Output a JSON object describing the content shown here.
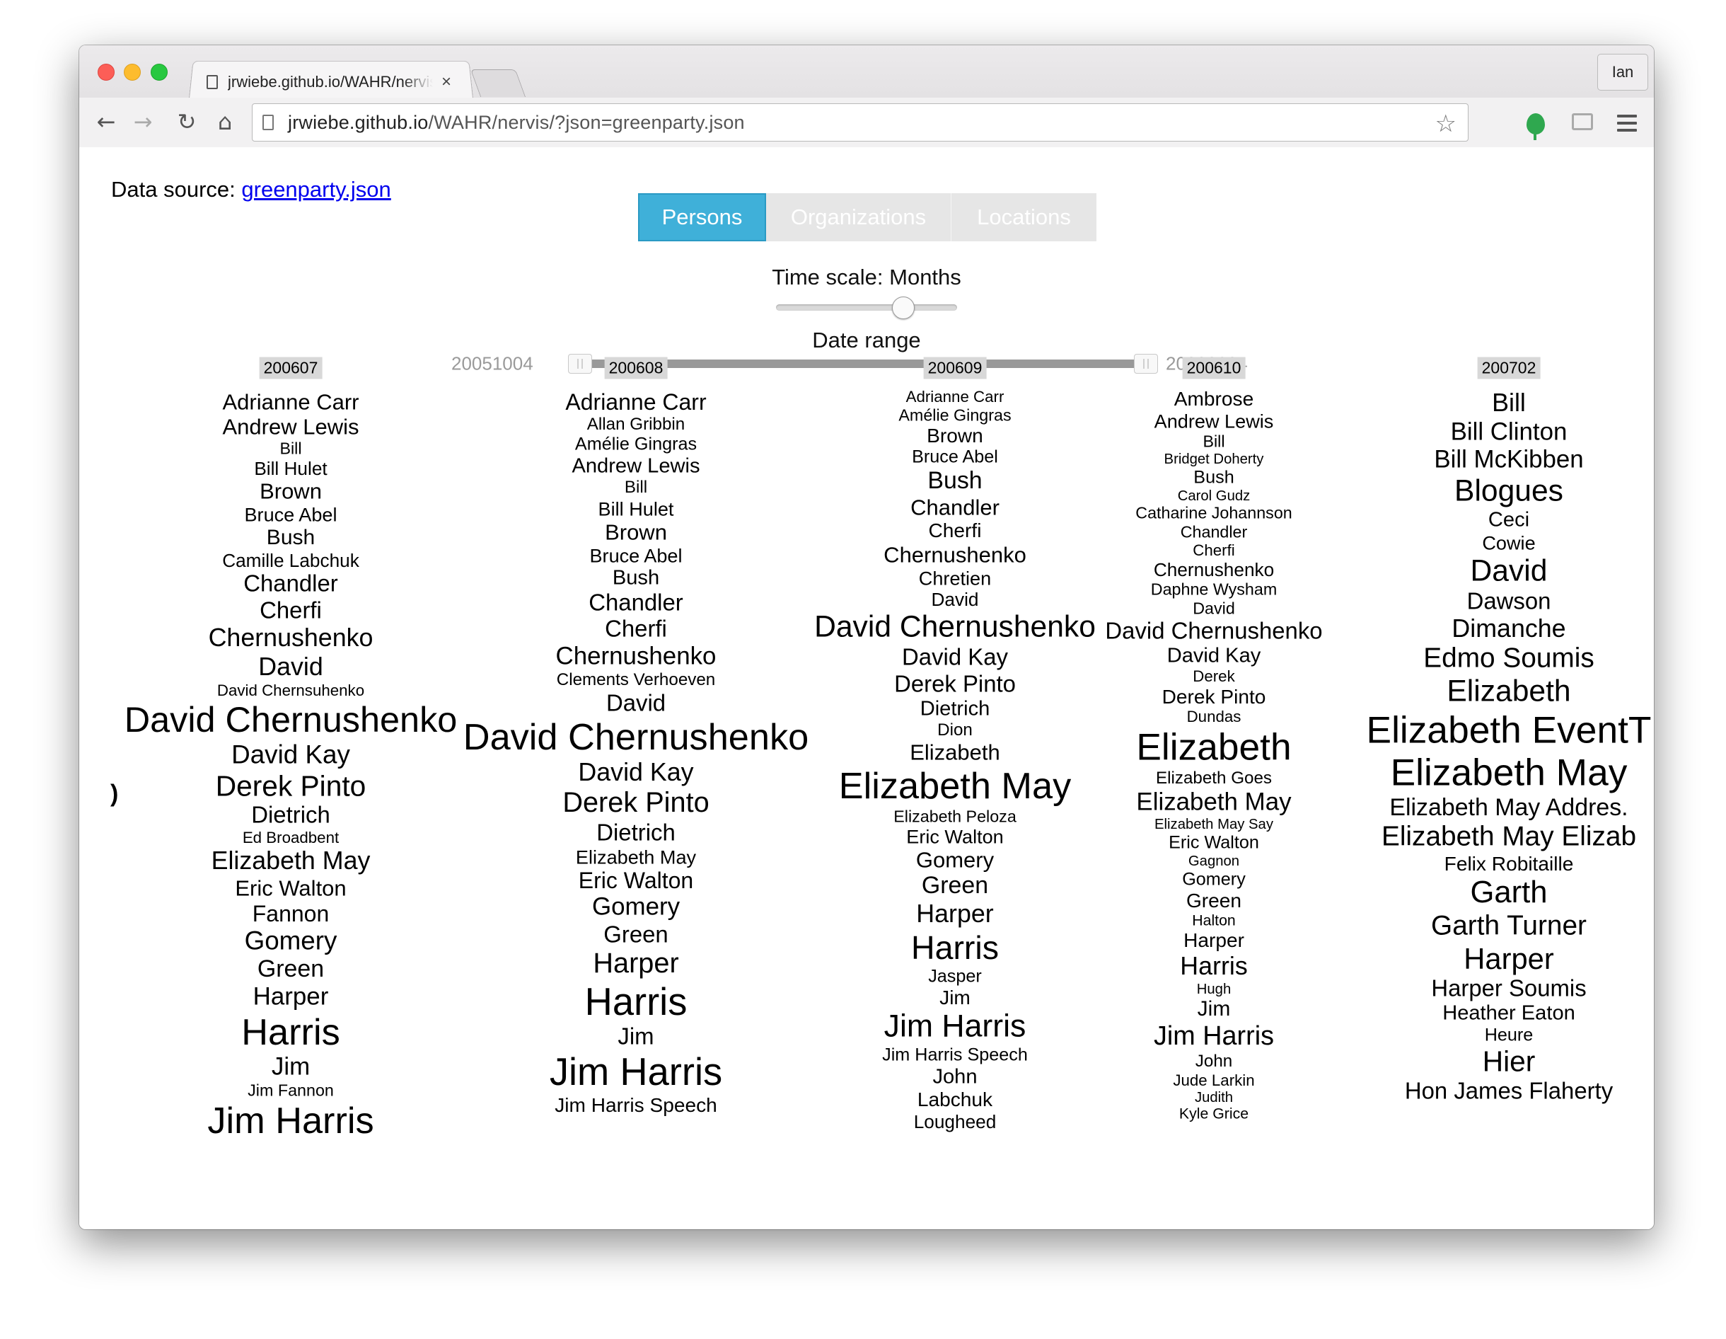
{
  "browser": {
    "tab_title": "jrwiebe.github.io/WAHR/nervis/?json=greenparty.json",
    "tab_close_glyph": "×",
    "profile_label": "Ian",
    "url_host": "jrwiebe.github.io",
    "url_path": "/WAHR/nervis/?json=greenparty.json",
    "icons": {
      "back": "back-arrow-icon",
      "forward": "forward-arrow-icon",
      "reload": "reload-icon",
      "home": "home-icon",
      "star": "star-icon",
      "extension": "evernote-extension-icon",
      "cast": "cast-icon",
      "menu": "hamburger-menu-icon"
    }
  },
  "page": {
    "data_source_label": "Data source:",
    "data_source_link": "greenparty.json",
    "tabs": [
      {
        "label": "Persons",
        "active": true
      },
      {
        "label": "Organizations",
        "active": false
      },
      {
        "label": "Locations",
        "active": false
      }
    ],
    "accent_color": "#3fb0d9",
    "time_scale_label": "Time scale: Months",
    "time_scale_value": "Months",
    "date_range_label": "Date range",
    "date_range_min": "20051004",
    "date_range_max": "20090204",
    "edge_glyph": ")"
  },
  "columns": [
    {
      "header": "200607",
      "words": [
        {
          "text": "Adrianne Carr",
          "size": 32
        },
        {
          "text": "Andrew Lewis",
          "size": 32
        },
        {
          "text": "Bill",
          "size": 24
        },
        {
          "text": "Bill Hulet",
          "size": 27
        },
        {
          "text": "Brown",
          "size": 32
        },
        {
          "text": "Bruce Abel",
          "size": 28
        },
        {
          "text": "Bush",
          "size": 31
        },
        {
          "text": "Camille Labchuk",
          "size": 27
        },
        {
          "text": "Chandler",
          "size": 34
        },
        {
          "text": "Cherfi",
          "size": 34
        },
        {
          "text": "Chernushenko",
          "size": 37
        },
        {
          "text": "David",
          "size": 37
        },
        {
          "text": "David Chernsuhenko",
          "size": 23
        },
        {
          "text": "David Chernushenko",
          "size": 52
        },
        {
          "text": "David Kay",
          "size": 38
        },
        {
          "text": "Derek Pinto",
          "size": 42
        },
        {
          "text": "Dietrich",
          "size": 34
        },
        {
          "text": "Ed Broadbent",
          "size": 23
        },
        {
          "text": "Elizabeth May",
          "size": 37
        },
        {
          "text": "Eric Walton",
          "size": 32
        },
        {
          "text": "Fannon",
          "size": 33
        },
        {
          "text": "Gomery",
          "size": 38
        },
        {
          "text": "Green",
          "size": 35
        },
        {
          "text": "Harper",
          "size": 36
        },
        {
          "text": "Harris",
          "size": 54
        },
        {
          "text": "Jim",
          "size": 36
        },
        {
          "text": "Jim Fannon",
          "size": 24
        },
        {
          "text": "Jim Harris",
          "size": 54
        }
      ]
    },
    {
      "header": "200608",
      "words": [
        {
          "text": "Adrianne Carr",
          "size": 33
        },
        {
          "text": "Allan Gribbin",
          "size": 25
        },
        {
          "text": "Amélie Gingras",
          "size": 26
        },
        {
          "text": "Andrew Lewis",
          "size": 30
        },
        {
          "text": "Bill",
          "size": 25
        },
        {
          "text": "Bill Hulet",
          "size": 28
        },
        {
          "text": "Brown",
          "size": 32
        },
        {
          "text": "Bruce Abel",
          "size": 28
        },
        {
          "text": "Bush",
          "size": 30
        },
        {
          "text": "Chandler",
          "size": 34
        },
        {
          "text": "Cherfi",
          "size": 34
        },
        {
          "text": "Chernushenko",
          "size": 36
        },
        {
          "text": "Clements Verhoeven",
          "size": 25
        },
        {
          "text": "David",
          "size": 34
        },
        {
          "text": "David Chernushenko",
          "size": 54
        },
        {
          "text": "David Kay",
          "size": 37
        },
        {
          "text": "Derek Pinto",
          "size": 41
        },
        {
          "text": "Dietrich",
          "size": 34
        },
        {
          "text": "Elizabeth May",
          "size": 28
        },
        {
          "text": "Eric Walton",
          "size": 33
        },
        {
          "text": "Gomery",
          "size": 36
        },
        {
          "text": "Green",
          "size": 34
        },
        {
          "text": "Harper",
          "size": 41
        },
        {
          "text": "Harris",
          "size": 56
        },
        {
          "text": "Jim",
          "size": 34
        },
        {
          "text": "Jim Harris",
          "size": 56
        },
        {
          "text": "Jim Harris Speech",
          "size": 29
        }
      ]
    },
    {
      "header": "200609",
      "words": [
        {
          "text": "Adrianne Carr",
          "size": 23
        },
        {
          "text": "Amélie Gingras",
          "size": 24
        },
        {
          "text": "Brown",
          "size": 29
        },
        {
          "text": "Bruce Abel",
          "size": 26
        },
        {
          "text": "Bush",
          "size": 35
        },
        {
          "text": "Chandler",
          "size": 32
        },
        {
          "text": "Cherfi",
          "size": 29
        },
        {
          "text": "Chernushenko",
          "size": 32
        },
        {
          "text": "Chretien",
          "size": 28
        },
        {
          "text": "David",
          "size": 27
        },
        {
          "text": "David Chernushenko",
          "size": 44
        },
        {
          "text": "David Kay",
          "size": 34
        },
        {
          "text": "Derek Pinto",
          "size": 34
        },
        {
          "text": "Dietrich",
          "size": 30
        },
        {
          "text": "Dion",
          "size": 25
        },
        {
          "text": "Elizabeth",
          "size": 32
        },
        {
          "text": "Elizabeth May",
          "size": 54
        },
        {
          "text": "Elizabeth Peloza",
          "size": 24
        },
        {
          "text": "Eric Walton",
          "size": 28
        },
        {
          "text": "Gomery",
          "size": 32
        },
        {
          "text": "Green",
          "size": 35
        },
        {
          "text": "Harper",
          "size": 37
        },
        {
          "text": "Harris",
          "size": 48
        },
        {
          "text": "Jasper",
          "size": 26
        },
        {
          "text": "Jim",
          "size": 29
        },
        {
          "text": "Jim Harris",
          "size": 46
        },
        {
          "text": "Jim Harris Speech",
          "size": 26
        },
        {
          "text": "John",
          "size": 30
        },
        {
          "text": "Labchuk",
          "size": 29
        },
        {
          "text": "Lougheed",
          "size": 27
        }
      ]
    },
    {
      "header": "200610",
      "words": [
        {
          "text": "Ambrose",
          "size": 29
        },
        {
          "text": "Andrew Lewis",
          "size": 28
        },
        {
          "text": "Bill",
          "size": 24
        },
        {
          "text": "Bridget Doherty",
          "size": 21
        },
        {
          "text": "Bush",
          "size": 26
        },
        {
          "text": "Carol Gudz",
          "size": 21
        },
        {
          "text": "Catharine Johannson",
          "size": 24
        },
        {
          "text": "Chandler",
          "size": 24
        },
        {
          "text": "Cherfi",
          "size": 23
        },
        {
          "text": "Chernushenko",
          "size": 27
        },
        {
          "text": "Daphne Wysham",
          "size": 24
        },
        {
          "text": "David",
          "size": 24
        },
        {
          "text": "David Chernushenko",
          "size": 34
        },
        {
          "text": "David Kay",
          "size": 30
        },
        {
          "text": "Derek",
          "size": 23
        },
        {
          "text": "Derek Pinto",
          "size": 29
        },
        {
          "text": "Dundas",
          "size": 23
        },
        {
          "text": "Elizabeth",
          "size": 55
        },
        {
          "text": "Elizabeth Goes",
          "size": 25
        },
        {
          "text": "Elizabeth May",
          "size": 36
        },
        {
          "text": "Elizabeth May Say",
          "size": 21
        },
        {
          "text": "Eric Walton",
          "size": 26
        },
        {
          "text": "Gagnon",
          "size": 21
        },
        {
          "text": "Gomery",
          "size": 26
        },
        {
          "text": "Green",
          "size": 29
        },
        {
          "text": "Halton",
          "size": 22
        },
        {
          "text": "Harper",
          "size": 29
        },
        {
          "text": "Harris",
          "size": 37
        },
        {
          "text": "Hugh",
          "size": 21
        },
        {
          "text": "Jim",
          "size": 31
        },
        {
          "text": "Jim Harris",
          "size": 39
        },
        {
          "text": "John",
          "size": 25
        },
        {
          "text": "Jude Larkin",
          "size": 23
        },
        {
          "text": "Judith",
          "size": 21
        },
        {
          "text": "Kyle Grice",
          "size": 22
        }
      ]
    },
    {
      "header": "200702",
      "words": [
        {
          "text": "Bill",
          "size": 37
        },
        {
          "text": "Bill Clinton",
          "size": 36
        },
        {
          "text": "Bill McKibben",
          "size": 36
        },
        {
          "text": "Blogues",
          "size": 44
        },
        {
          "text": "Ceci",
          "size": 30
        },
        {
          "text": "Cowie",
          "size": 28
        },
        {
          "text": "David",
          "size": 44
        },
        {
          "text": "Dawson",
          "size": 34
        },
        {
          "text": "Dimanche",
          "size": 37
        },
        {
          "text": "Edmo Soumis",
          "size": 40
        },
        {
          "text": "Elizabeth",
          "size": 44
        },
        {
          "text": "Elizabeth EventT",
          "size": 55
        },
        {
          "text": "Elizabeth May",
          "size": 55
        },
        {
          "text": "Elizabeth May Addres.",
          "size": 35
        },
        {
          "text": "Elizabeth May Elizab",
          "size": 40
        },
        {
          "text": "Felix Robitaille",
          "size": 29
        },
        {
          "text": "Garth",
          "size": 45
        },
        {
          "text": "Garth Turner",
          "size": 40
        },
        {
          "text": "Harper",
          "size": 43
        },
        {
          "text": "Harper Soumis",
          "size": 34
        },
        {
          "text": "Heather Eaton",
          "size": 30
        },
        {
          "text": "Heure",
          "size": 26
        },
        {
          "text": "Hier",
          "size": 42
        },
        {
          "text": "Hon James Flaherty",
          "size": 34
        }
      ]
    }
  ]
}
